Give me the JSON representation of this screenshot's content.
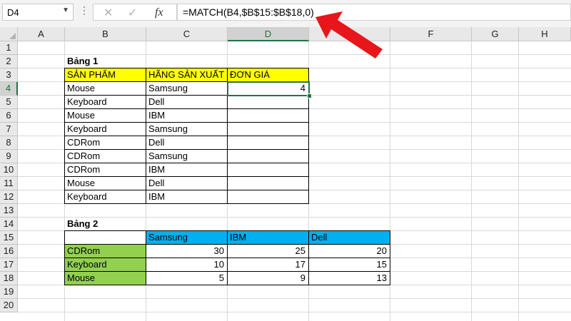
{
  "name_box": {
    "value": "D4"
  },
  "formula_bar": {
    "cancel_icon": "x-icon",
    "enter_icon": "check-icon",
    "fx_label": "fx",
    "formula": "=MATCH(B4,$B$15:$B$18,0)"
  },
  "columns": [
    "A",
    "B",
    "C",
    "D",
    "E",
    "F",
    "G",
    "H"
  ],
  "rows": [
    "1",
    "2",
    "3",
    "4",
    "5",
    "6",
    "7",
    "8",
    "9",
    "10",
    "11",
    "12",
    "13",
    "14",
    "15",
    "16",
    "17",
    "18",
    "19",
    "20"
  ],
  "selected": {
    "column": "D",
    "row": "4"
  },
  "table1": {
    "title": "Bảng 1",
    "headers": [
      "SẢN PHẨM",
      "HÃNG SẢN XUẤT",
      "ĐƠN GIÁ"
    ],
    "rows": [
      {
        "product": "Mouse",
        "maker": "Samsung",
        "price": "4"
      },
      {
        "product": "Keyboard",
        "maker": "Dell",
        "price": ""
      },
      {
        "product": "Mouse",
        "maker": "IBM",
        "price": ""
      },
      {
        "product": "Keyboard",
        "maker": "Samsung",
        "price": ""
      },
      {
        "product": "CDRom",
        "maker": "Dell",
        "price": ""
      },
      {
        "product": "CDRom",
        "maker": "Samsung",
        "price": ""
      },
      {
        "product": "CDRom",
        "maker": "IBM",
        "price": ""
      },
      {
        "product": "Mouse",
        "maker": "Dell",
        "price": ""
      },
      {
        "product": "Keyboard",
        "maker": "IBM",
        "price": ""
      }
    ]
  },
  "table2": {
    "title": "Bảng 2",
    "headers": [
      "",
      "Samsung",
      "IBM",
      "Dell"
    ],
    "rows": [
      {
        "product": "CDRom",
        "values": [
          "30",
          "25",
          "20"
        ]
      },
      {
        "product": "Keyboard",
        "values": [
          "10",
          "17",
          "15"
        ]
      },
      {
        "product": "Mouse",
        "values": [
          "5",
          "9",
          "13"
        ]
      }
    ]
  },
  "colors": {
    "header_yellow": "#ffff00",
    "header_blue": "#00b0f0",
    "label_green": "#92d050",
    "selection_green": "#217346",
    "arrow_red": "#e8151b"
  }
}
